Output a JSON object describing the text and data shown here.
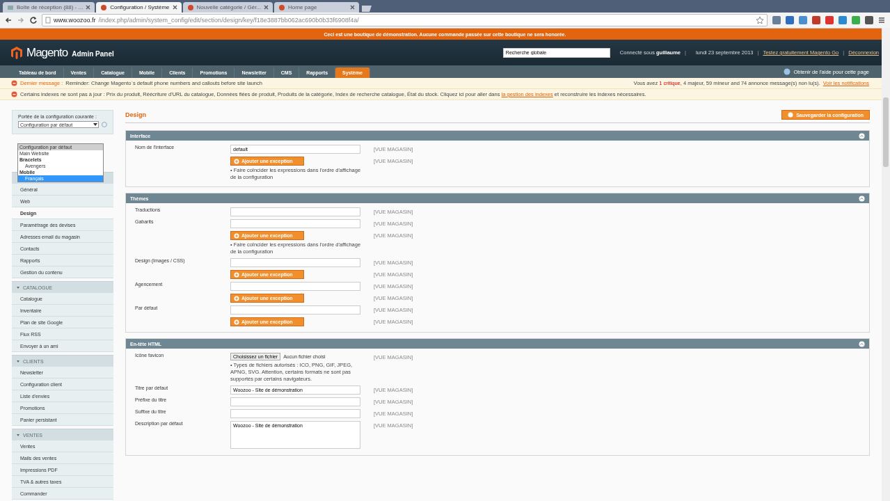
{
  "browser": {
    "tabs": [
      {
        "title": "Boîte de réception (88) - ...",
        "selected": false
      },
      {
        "title": "Configuration / Système",
        "selected": true
      },
      {
        "title": "Nouvelle catégorie / Gér...",
        "selected": false
      },
      {
        "title": "Home page",
        "selected": false
      }
    ],
    "url_host": "www.woozoo.fr",
    "url_path": "/index.php/admin/system_config/edit/section/design/key/f18e3887bb062ac690b0b33f6908f4a/"
  },
  "demo_notice": "Ceci est une boutique de démonstration. Aucune commande passée sur cette boutique ne sera honorée.",
  "header": {
    "logo": "Magento",
    "subtitle": "Admin Panel",
    "search": {
      "value": "Recherche globale"
    },
    "user_prefix": "Connecté sous",
    "user": "guillaume",
    "separators": [
      "|",
      "|",
      "|"
    ],
    "date": "lundi 23 septembre 2013",
    "links": [
      "Testez gratuitement Magento Go",
      "Déconnexion"
    ]
  },
  "nav": {
    "items": [
      {
        "label": "Tableau de bord",
        "selected": false
      },
      {
        "label": "Ventes",
        "selected": false
      },
      {
        "label": "Catalogue",
        "selected": false
      },
      {
        "label": "Mobile",
        "selected": false
      },
      {
        "label": "Clients",
        "selected": false
      },
      {
        "label": "Promotions",
        "selected": false
      },
      {
        "label": "Newsletter",
        "selected": false
      },
      {
        "label": "CMS",
        "selected": false
      },
      {
        "label": "Rapports",
        "selected": false
      },
      {
        "label": "Système",
        "selected": true
      }
    ],
    "help": "Obtenir de l'aide pour cette page"
  },
  "messages": [
    {
      "kind": "latest",
      "title": "Dernier message :",
      "text": "Reminder: Change Magento`s default phone numbers and callouts before site launch",
      "summary": "Vous avez **1 critique**, 4 majeur, 59 mineur and 74 annonce message(s) non lu(s).",
      "summary_link": "Voir les notifications"
    },
    {
      "kind": "index",
      "text": "Certains indexes ne sont pas à jour : Prix du produit, Réécriture d'URL du catalogue, Données fiées de produit, Produits de la catégorie, Index de recherche catalogue, État du stock. Cliquez ici pour aller dans",
      "link": "la gestion des indexes",
      "text_after": "et reconstruire les indexes nécessaires."
    }
  ],
  "sidebar": {
    "scope_label": "Portée de la configuration courante :",
    "scope_value": "Configuration par défaut",
    "options": [
      {
        "label": "Configuration par défaut",
        "selected": true,
        "highlighted": false
      },
      {
        "label": "Main Website",
        "selected": false,
        "highlighted": false
      },
      {
        "label": "Bracelets",
        "kind": "group",
        "children": [
          {
            "label": "Avengers",
            "selected": false,
            "highlighted": false
          }
        ]
      },
      {
        "label": "Mobile",
        "kind": "group",
        "children": [
          {
            "label": "Français",
            "selected": false,
            "highlighted": true
          }
        ]
      }
    ],
    "groups": [
      {
        "items": [
          {
            "label": "Général",
            "selected": false
          },
          {
            "label": "Web",
            "selected": false
          },
          {
            "label": "Design",
            "selected": true
          },
          {
            "label": "Paramétrage des devises",
            "selected": false
          },
          {
            "label": "Adresses email du magasin",
            "selected": false
          },
          {
            "label": "Contacts",
            "selected": false
          },
          {
            "label": "Rapports",
            "selected": false
          },
          {
            "label": "Gestion du contenu",
            "selected": false
          }
        ]
      },
      {
        "title": "CATALOGUE",
        "items": [
          {
            "label": "Catalogue",
            "selected": false
          },
          {
            "label": "Inventaire",
            "selected": false
          },
          {
            "label": "Plan de site Google",
            "selected": false
          },
          {
            "label": "Flux RSS",
            "selected": false
          },
          {
            "label": "Envoyer à un ami",
            "selected": false
          }
        ]
      },
      {
        "title": "CLIENTS",
        "items": [
          {
            "label": "Newsletter",
            "selected": false
          },
          {
            "label": "Configuration client",
            "selected": false
          },
          {
            "label": "Liste d'envies",
            "selected": false
          },
          {
            "label": "Promotions",
            "selected": false
          },
          {
            "label": "Panier persistant",
            "selected": false
          }
        ]
      },
      {
        "title": "VENTES",
        "items": [
          {
            "label": "Ventes",
            "selected": false
          },
          {
            "label": "Mails des ventes",
            "selected": false
          },
          {
            "label": "Impressions PDF",
            "selected": false
          },
          {
            "label": "TVA & autres taxes",
            "selected": false
          },
          {
            "label": "Commander",
            "selected": false
          }
        ]
      }
    ]
  },
  "main": {
    "title": "Design",
    "save": "Sauvegarder la configuration",
    "sections": [
      {
        "title": "Interface",
        "rows": [
          {
            "kind": "text",
            "label": "Nom de l'interface",
            "value": "default",
            "scope": "[VUE MAGASIN]"
          },
          {
            "kind": "exception",
            "button": "Ajouter une exception",
            "note": "• Faire coïncider les expressions dans l'ordre d'affichage de la configuration",
            "scope": "[VUE MAGASIN]"
          }
        ]
      },
      {
        "title": "Thèmes",
        "rows": [
          {
            "kind": "text",
            "label": "Traductions",
            "scope": "[VUE MAGASIN]"
          },
          {
            "kind": "text",
            "label": "Gabarits",
            "scope": "[VUE MAGASIN]"
          },
          {
            "kind": "exception",
            "button": "Ajouter une exception",
            "note": "• Faire coïncider les expressions dans l'ordre d'affichage de la configuration",
            "scope": "[VUE MAGASIN]"
          },
          {
            "kind": "text",
            "label": "Design (Images / CSS)",
            "scope": "[VUE MAGASIN]"
          },
          {
            "kind": "exception",
            "button": "Ajouter une exception",
            "scope": "[VUE MAGASIN]"
          },
          {
            "kind": "text",
            "label": "Agencement",
            "scope": "[VUE MAGASIN]"
          },
          {
            "kind": "exception",
            "button": "Ajouter une exception",
            "scope": "[VUE MAGASIN]"
          },
          {
            "kind": "text",
            "label": "Par défaut",
            "scope": "[VUE MAGASIN]"
          },
          {
            "kind": "exception",
            "button": "Ajouter une exception",
            "scope": "[VUE MAGASIN]"
          }
        ]
      },
      {
        "title": "En-tête HTML",
        "rows": [
          {
            "kind": "file",
            "label": "Icône favicon",
            "button": "Choisissez un fichier",
            "value": "Aucun fichier choisi",
            "note": "• Types de fichiers autorisés : ICO, PNG, GIF, JPEG, APNG, SVG. Attention, certains formats ne sont pas supportés par certains navigateurs.",
            "scope": "[VUE MAGASIN]"
          },
          {
            "kind": "text",
            "label": "Titre par défaut",
            "value": "Woozoo - Site de démonstration",
            "scope": "[VUE MAGASIN]"
          },
          {
            "kind": "text",
            "label": "Préfixe du titre",
            "scope": "[VUE MAGASIN]"
          },
          {
            "kind": "text",
            "label": "Suffixe du titre",
            "scope": "[VUE MAGASIN]"
          },
          {
            "kind": "textarea",
            "label": "Description par défaut",
            "value": "Woozoo - Site de démonstration",
            "scope": "[VUE MAGASIN]"
          }
        ]
      }
    ]
  }
}
